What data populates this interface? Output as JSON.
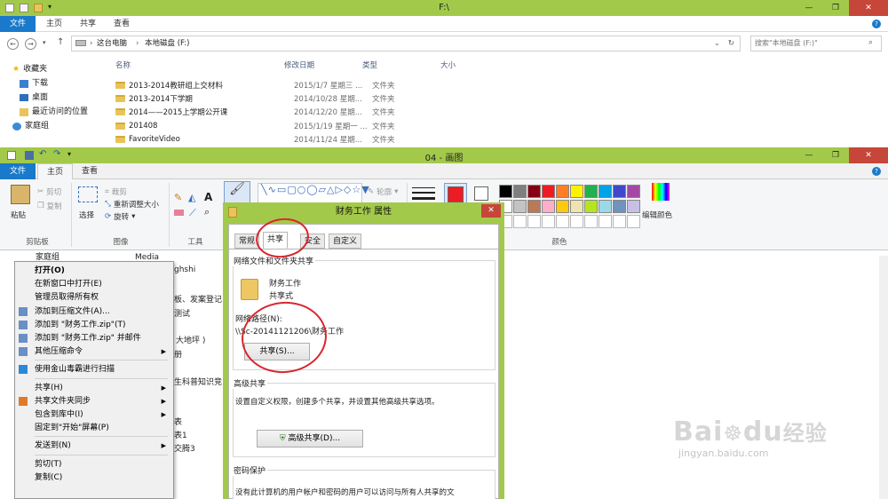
{
  "explorer": {
    "title": "F:\\",
    "tabs": [
      "文件",
      "主页",
      "共享",
      "查看"
    ],
    "address": {
      "segments": [
        "这台电脑",
        "本地磁盘 (F:)"
      ]
    },
    "search_placeholder": "搜索\"本地磁盘 (F:)\"",
    "sidebar": [
      "收藏夹",
      "下载",
      "桌面",
      "最近访问的位置",
      "家庭组"
    ],
    "columns": [
      "名称",
      "修改日期",
      "类型",
      "大小"
    ],
    "rows": [
      {
        "name": "2013-2014教研组上交材料",
        "date": "2015/1/7 星期三 ...",
        "type": "文件夹"
      },
      {
        "name": "2013-2014下学期",
        "date": "2014/10/28 星期...",
        "type": "文件夹"
      },
      {
        "name": "2014——2015上学期公开课",
        "date": "2014/12/20 星期...",
        "type": "文件夹"
      },
      {
        "name": "201408",
        "date": "2015/1/19 星期一 ...",
        "type": "文件夹"
      },
      {
        "name": "FavoriteVideo",
        "date": "2014/11/24 星期...",
        "type": "文件夹"
      }
    ]
  },
  "paint": {
    "title": "04 - 画图",
    "tabs": [
      "文件",
      "主页",
      "查看"
    ],
    "clipboard": {
      "paste": "粘贴",
      "cut": "剪切",
      "copy": "复制",
      "group": "剪贴板"
    },
    "image": {
      "select": "选择",
      "crop": "裁剪",
      "resize": "重新调整大小",
      "rotate": "旋转",
      "group": "图像"
    },
    "tools_group": "工具",
    "shapes": {
      "outline": "轮廓",
      "fill": "填充"
    },
    "colors": {
      "edit": "编辑颜色",
      "group": "颜色",
      "palette_row1": [
        "#000000",
        "#7f7f7f",
        "#880015",
        "#ed1c24",
        "#ff7f27",
        "#fff200",
        "#22b14c",
        "#00a2e8",
        "#3f48cc",
        "#a349a4"
      ],
      "palette_row2": [
        "#ffffff",
        "#c3c3c3",
        "#b97a57",
        "#ffaec9",
        "#ffc90e",
        "#efe4b0",
        "#b5e61d",
        "#99d9ea",
        "#7092be",
        "#c8bfe7"
      ],
      "color1": "#ed1c24",
      "color2": "#ffffff"
    },
    "background_text": [
      "家庭组",
      "Media",
      "ghshi",
      "板、发案登记",
      "测试",
      "大地坪 )",
      "册",
      "生科普知识竞",
      "表",
      "表1",
      "交腾3"
    ]
  },
  "context_menu": {
    "items": [
      {
        "label": "打开(O)",
        "bold": true
      },
      {
        "label": "在新窗口中打开(E)"
      },
      {
        "label": "管理员取得所有权"
      },
      {
        "label": "添加到压缩文件(A)...",
        "icon": "archive-icon"
      },
      {
        "label": "添加到 \"财务工作.zip\"(T)",
        "icon": "archive-icon"
      },
      {
        "label": "添加到 \"财务工作.zip\" 并邮件",
        "icon": "archive-icon"
      },
      {
        "label": "其他压缩命令",
        "icon": "archive-icon",
        "submenu": true
      },
      {
        "sep": true
      },
      {
        "label": "使用金山毒霸进行扫描",
        "icon": "shield-icon"
      },
      {
        "sep": true
      },
      {
        "label": "共享(H)",
        "submenu": true
      },
      {
        "label": "共享文件夹同步",
        "icon": "sync-icon",
        "submenu": true
      },
      {
        "label": "包含到库中(I)",
        "submenu": true
      },
      {
        "label": "固定到\"开始\"屏幕(P)"
      },
      {
        "sep": true
      },
      {
        "label": "发送到(N)",
        "submenu": true
      },
      {
        "sep": true
      },
      {
        "label": "剪切(T)"
      },
      {
        "label": "复制(C)"
      }
    ]
  },
  "dialog": {
    "title": "财务工作 属性",
    "close": "✕",
    "tabs": [
      "常规",
      "共享",
      "安全",
      "自定义"
    ],
    "network_section": "网络文件和文件夹共享",
    "folder_name": "财务工作",
    "share_state": "共享式",
    "network_path_label": "网络路径(N):",
    "network_path": "\\\\Sc-20141121206\\财务工作",
    "share_button": "共享(S)...",
    "advanced_section": "高级共享",
    "advanced_desc": "设置自定义权限，创建多个共享，并设置其他高级共享选项。",
    "advanced_button": "高级共享(D)...",
    "password_section": "密码保护",
    "password_desc": "没有此计算机的用户帐户和密码的用户可以访问与所有人共享的文"
  },
  "watermark": {
    "brand": "Bai",
    "brand2": "du",
    "slogan": "经验",
    "url": "jingyan.baidu.com"
  },
  "accent": "#a3c94a",
  "highlight": "#d9262e"
}
